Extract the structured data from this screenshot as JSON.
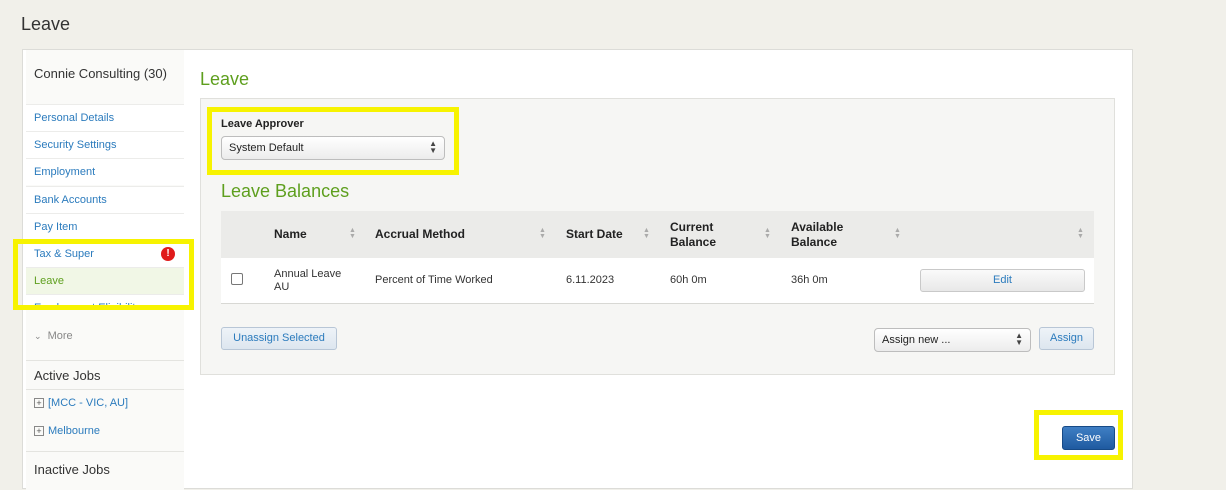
{
  "page": {
    "title": "Leave"
  },
  "sidebar": {
    "company": "Connie Consulting (30)",
    "items": [
      {
        "label": "Personal Details"
      },
      {
        "label": "Security Settings"
      },
      {
        "label": "Employment"
      },
      {
        "label": "Bank Accounts"
      },
      {
        "label": "Pay Item"
      },
      {
        "label": "Tax & Super",
        "alert": "!"
      },
      {
        "label": "Leave",
        "active": true
      },
      {
        "label": "Employment Eligibility"
      }
    ],
    "more_label": "More",
    "active_jobs": {
      "title": "Active Jobs",
      "items": [
        {
          "label": "[MCC - VIC, AU]"
        },
        {
          "label": "Melbourne"
        }
      ]
    },
    "inactive_jobs": {
      "title": "Inactive Jobs"
    }
  },
  "main": {
    "title": "Leave",
    "approver": {
      "label": "Leave Approver",
      "selected": "System Default"
    },
    "balances": {
      "title": "Leave Balances",
      "columns": [
        "Name",
        "Accrual Method",
        "Start Date",
        "Current Balance",
        "Available Balance"
      ],
      "rows": [
        {
          "name": "Annual Leave AU",
          "accrual_method": "Percent of Time Worked",
          "start_date": "6.11.2023",
          "current_balance": "60h 0m",
          "available_balance": "36h 0m",
          "action": "Edit"
        }
      ]
    },
    "unassign_label": "Unassign Selected",
    "assign_select": "Assign new ...",
    "assign_label": "Assign",
    "save_label": "Save"
  },
  "colors": {
    "accent_green": "#5e9f1e",
    "link_blue": "#2b7bbd",
    "highlight": "#f7f300",
    "save_blue": "#1f5aa0",
    "alert_red": "#e01b1b"
  }
}
